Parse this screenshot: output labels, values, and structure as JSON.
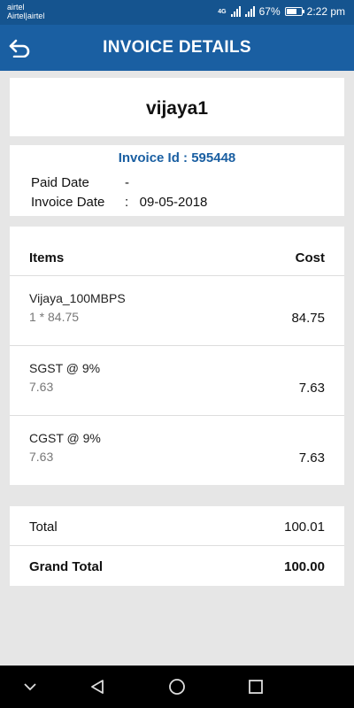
{
  "status_bar": {
    "carrier_line1": "airtel",
    "carrier_line2": "Airtel|airtel",
    "network": "4G",
    "battery": "67%",
    "time": "2:22 pm"
  },
  "header": {
    "title": "INVOICE DETAILS",
    "back_icon": "back-arrow-icon"
  },
  "customer": {
    "name": "vijaya1"
  },
  "invoice": {
    "id_label": "Invoice Id : 595448",
    "paid_date_label": "Paid Date",
    "paid_date_value": "-",
    "invoice_date_label": "Invoice Date",
    "invoice_date_value": ":   09-05-2018"
  },
  "items": {
    "header_items": "Items",
    "header_cost": "Cost",
    "rows": [
      {
        "name": "Vijaya_100MBPS",
        "detail": "1 * 84.75",
        "cost": "84.75"
      },
      {
        "name": "SGST @ 9%",
        "detail": "7.63",
        "cost": "7.63"
      },
      {
        "name": "CGST @ 9%",
        "detail": "7.63",
        "cost": "7.63"
      }
    ]
  },
  "totals": {
    "total_label": "Total",
    "total_value": "100.01",
    "grand_total_label": "Grand Total",
    "grand_total_value": "100.00"
  },
  "nav_bar": {
    "icons": [
      "chevron-down-icon",
      "back-triangle-icon",
      "home-circle-icon",
      "recents-square-icon"
    ]
  },
  "colors": {
    "primary": "#1a5fa2",
    "status_bar": "#15548f",
    "background": "#e6e6e6"
  }
}
